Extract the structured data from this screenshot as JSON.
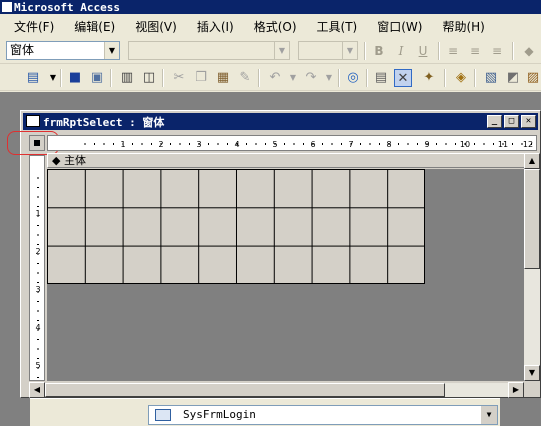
{
  "app": {
    "title": "Microsoft Access"
  },
  "menu": {
    "items": [
      "文件(F)",
      "编辑(E)",
      "视图(V)",
      "插入(I)",
      "格式(O)",
      "工具(T)",
      "窗口(W)",
      "帮助(H)"
    ]
  },
  "format_toolbar": {
    "object_combo": "窗体",
    "bold": "B",
    "italic": "I",
    "underline": "U"
  },
  "form_window": {
    "title": "frmRptSelect : 窗体",
    "section_label": "主体",
    "ruler_h_labels": [
      "1",
      "2",
      "3",
      "4",
      "5",
      "6",
      "7",
      "8",
      "9",
      "10",
      "11",
      "12"
    ],
    "ruler_v_labels": [
      "1",
      "2",
      "3",
      "4",
      "5"
    ]
  },
  "bottom": {
    "object_combo": "SysFrmLogin"
  }
}
